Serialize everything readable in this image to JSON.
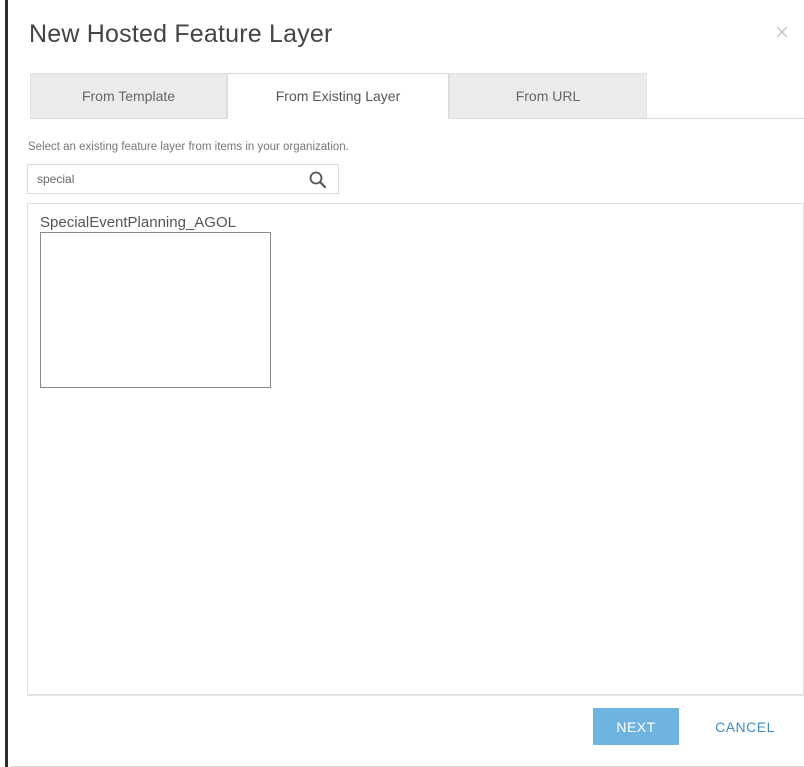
{
  "dialog": {
    "title": "New Hosted Feature Layer",
    "close_icon": "close-icon"
  },
  "tabs": [
    {
      "label": "From Template",
      "active": false
    },
    {
      "label": "From Existing Layer",
      "active": true
    },
    {
      "label": "From URL",
      "active": false
    }
  ],
  "instruction": "Select an existing feature layer from items in your organization.",
  "search": {
    "value": "special",
    "icon": "search-icon"
  },
  "results": [
    {
      "title": "SpecialEventPlanning_AGOL"
    }
  ],
  "footer": {
    "next_label": "NEXT",
    "cancel_label": "CANCEL"
  },
  "colors": {
    "primary_button": "#6fb3e0",
    "link": "#3f8dc4"
  }
}
